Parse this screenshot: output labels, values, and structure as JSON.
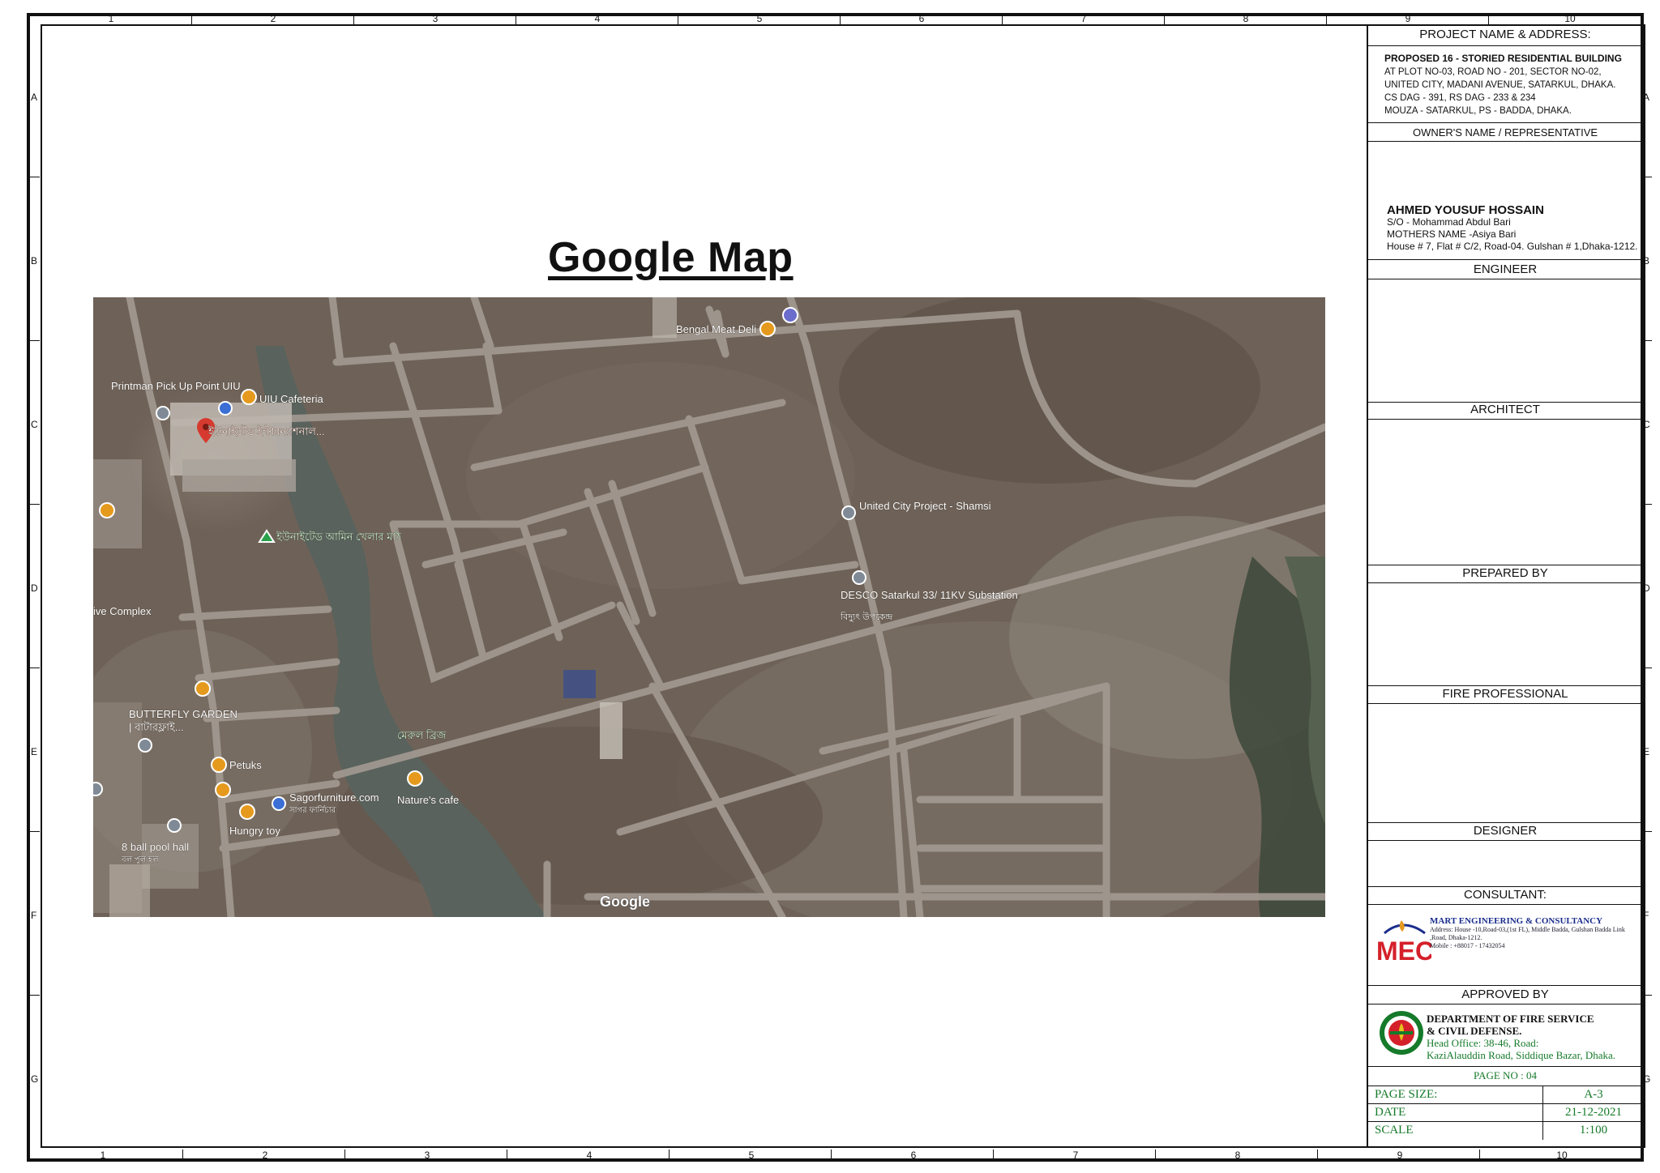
{
  "sheet": {
    "columns": [
      "1",
      "2",
      "3",
      "4",
      "5",
      "6",
      "7",
      "8",
      "9",
      "10"
    ],
    "rows": [
      "A",
      "B",
      "C",
      "D",
      "E",
      "F",
      "G"
    ]
  },
  "main": {
    "title": "Google Map",
    "map_labels": {
      "printman": "Printman Pick Up Point UIU",
      "uiu_cafeteria": "UIU Cafeteria",
      "uiu_bn": "ইউনাইটেড ইন্টারন্যাশনাল...",
      "field_bn": "ইউনাইটেড আমিন খেলার মাঠ",
      "complex": "ive Complex",
      "bengal_meat": "Bengal Meat Deli",
      "united_city": "United City Project - Shamsi",
      "desco": "DESCO Satarkul 33/ 11KV Substation",
      "desco_bn": "বিদ্যুৎ উপকেন্দ্র",
      "butterfly": "BUTTERFLY GARDEN",
      "butterfly_bn": "| বাটারফ্লাই...",
      "petuks": "Petuks",
      "sagor": "Sagorfurniture.com",
      "sagor_bn": "সাগর ফার্নিচার",
      "natures": "Nature's cafe",
      "bridge_bn": "মেরুল ব্রিজ",
      "hungry": "Hungry toy",
      "pool": "8 ball pool hall",
      "pool_bn": "বল পুল হল",
      "google": "Google"
    }
  },
  "title_block": {
    "project_header": "PROJECT NAME & ADDRESS:",
    "project_lines": [
      "PROPOSED 16 - STORIED RESIDENTIAL BUILDING",
      "AT PLOT NO-03, ROAD NO - 201, SECTOR NO-02,",
      "UNITED CITY, MADANI AVENUE, SATARKUL, DHAKA.",
      "CS DAG - 391, RS DAG - 233 & 234",
      "MOUZA - SATARKUL, PS - BADDA, DHAKA."
    ],
    "owner_header": "OWNER'S NAME / REPRESENTATIVE",
    "owner_name": "AHMED YOUSUF HOSSAIN",
    "owner_lines": [
      "S/O - Mohammad Abdul Bari",
      "MOTHERS NAME -Asiya Bari",
      "House # 7, Flat # C/2, Road-04. Gulshan # 1,Dhaka-1212."
    ],
    "engineer": "ENGINEER",
    "architect": "ARCHITECT",
    "prepared_by": "PREPARED BY",
    "fire_professional": "FIRE PROFESSIONAL",
    "designer": "DESIGNER",
    "consultant": "CONSULTANT:",
    "mec_logo": "MEC",
    "mec_name": "MART ENGINEERING & CONSULTANCY",
    "mec_address": "Address: House -10,Road-03,(1st FL), Middle Badda, Gulshan Badda Link ,Road, Dhaka-1212.",
    "mec_mobile": "Mobile : +88017 - 17432054",
    "approved_by": "APPROVED BY",
    "fire_dept_1": "DEPARTMENT OF FIRE SERVICE",
    "fire_dept_2": "& CIVIL DEFENSE.",
    "fire_addr_1": "Head Office: 38-46, Road:",
    "fire_addr_2": "KaziAlauddin Road, Siddique Bazar, Dhaka.",
    "page_no": "PAGE NO : 04",
    "page_size_label": "PAGE SIZE:",
    "page_size": "A-3",
    "date_label": "DATE",
    "date": "21-12-2021",
    "scale_label": "SCALE",
    "scale": "1:100"
  },
  "colors": {
    "map_base": "#6e6258",
    "road": "#a39a92",
    "pin_red": "#d63a2f",
    "pin_orange": "#e59a1e",
    "pin_blue": "#3b6fd6",
    "pin_gray": "#7f8a96",
    "pin_green": "#2aa14a",
    "water": "#59625c",
    "title_green": "#157a2a",
    "mec_red": "#d4202a",
    "mec_blue": "#1a2d8c"
  }
}
